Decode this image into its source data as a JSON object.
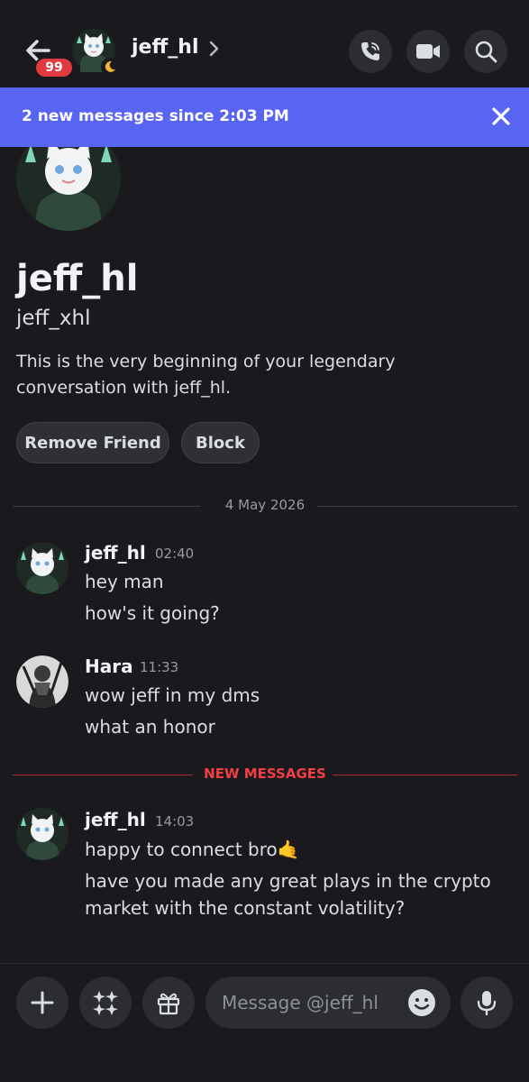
{
  "header": {
    "unread_badge": "99",
    "channel_name": "jeff_hl"
  },
  "banner": {
    "text": "2 new messages since 2:03 PM"
  },
  "profile": {
    "display_name": "jeff_hl",
    "username": "jeff_xhl",
    "description": "This is the very beginning of your legendary conversation with jeff_hl.",
    "remove_friend_label": "Remove Friend",
    "block_label": "Block"
  },
  "date_divider": "4 May 2026",
  "messages": [
    {
      "author": "jeff_hl",
      "time": "02:40",
      "lines": [
        "hey man",
        "how's it going?"
      ]
    },
    {
      "author": "Hara",
      "time": "11:33",
      "lines": [
        "wow jeff in my dms",
        "what an honor"
      ]
    },
    {
      "author": "jeff_hl",
      "time": "14:03",
      "lines": [
        "happy to connect bro🤙",
        "have you made any great plays in the crypto",
        "market with the constant volatility?"
      ]
    }
  ],
  "new_messages_label": "NEW MESSAGES",
  "composer": {
    "placeholder": "Message @jeff_hl"
  },
  "colors": {
    "background": "#1a1a1e",
    "accent": "#5865f2",
    "badge": "#e03a3e",
    "new_messages": "#f23f43"
  }
}
